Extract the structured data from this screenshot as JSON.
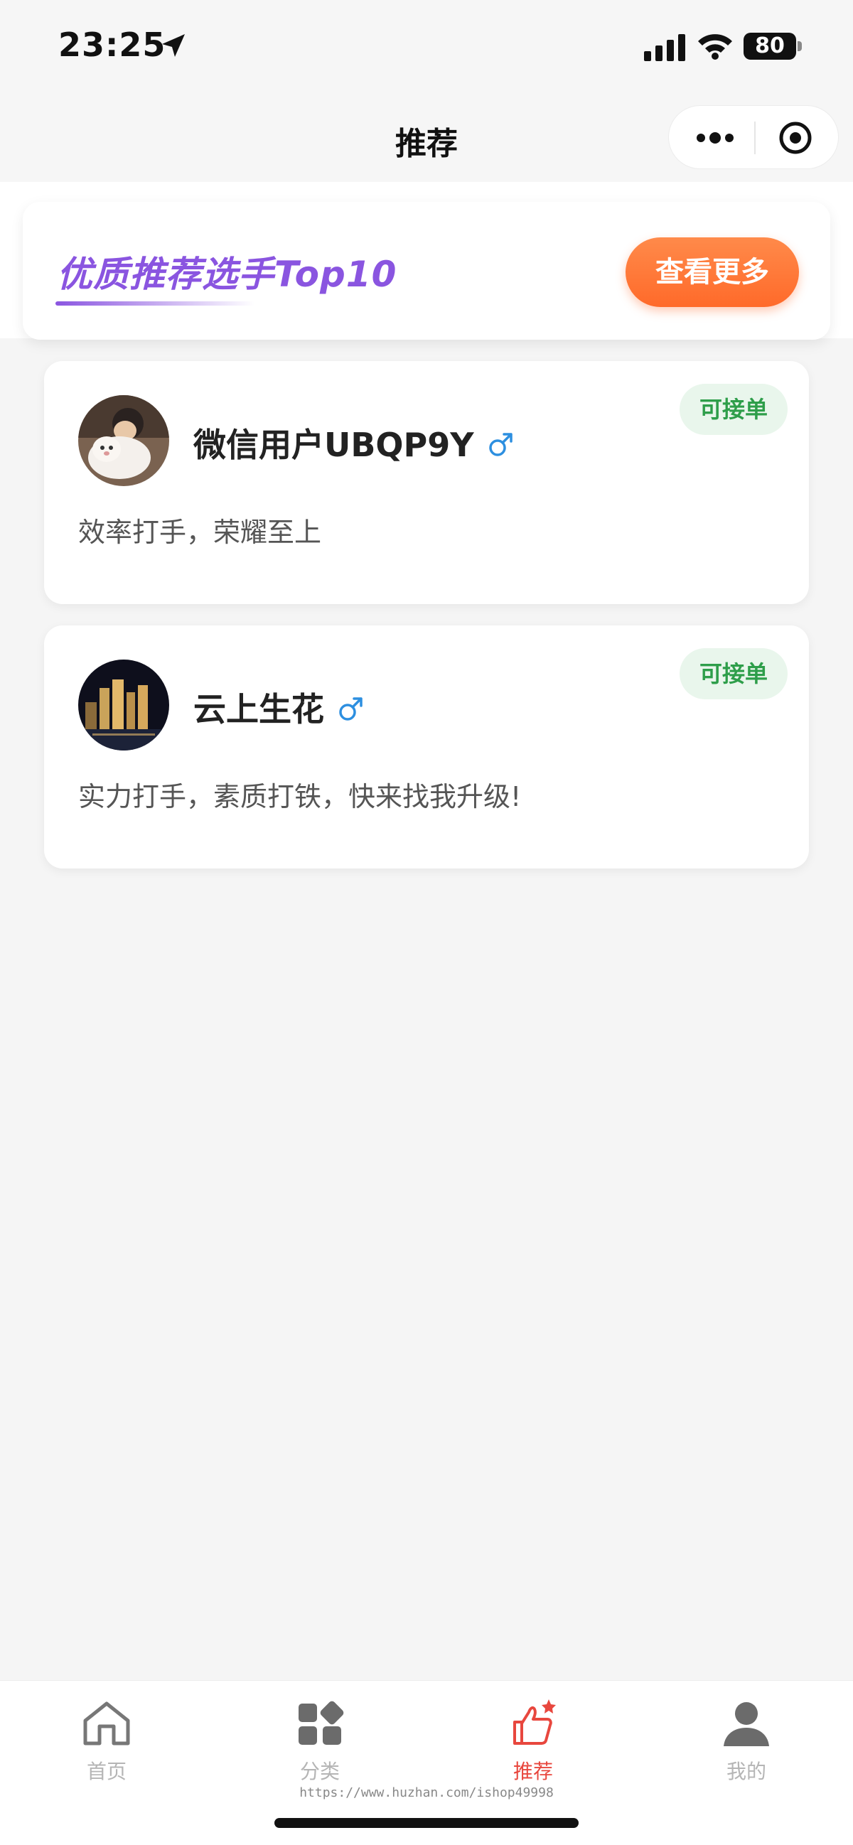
{
  "status_bar": {
    "time": "23:25",
    "battery": "80"
  },
  "nav": {
    "title": "推荐"
  },
  "banner": {
    "title": "优质推荐选手Top10",
    "button_label": "查看更多"
  },
  "users": [
    {
      "name": "微信用户UBQP9Y",
      "gender": "male",
      "badge": "可接单",
      "desc": "效率打手，荣耀至上"
    },
    {
      "name": "云上生花",
      "gender": "male",
      "badge": "可接单",
      "desc": "实力打手，素质打铁，快来找我升级!"
    }
  ],
  "tab_bar": {
    "items": [
      {
        "label": "首页",
        "icon": "home-icon"
      },
      {
        "label": "分类",
        "icon": "category-icon"
      },
      {
        "label": "推荐",
        "icon": "thumbs-up-icon"
      },
      {
        "label": "我的",
        "icon": "user-icon"
      }
    ],
    "active": "推荐"
  },
  "watermark": "https://www.huzhan.com/ishop49998",
  "colors": {
    "accent_purple": "#8a55e0",
    "button_orange": "#ff6a2a",
    "badge_green": "#2e9e4a",
    "active_tab": "#e8473e",
    "gender_blue": "#2d8fe0"
  }
}
